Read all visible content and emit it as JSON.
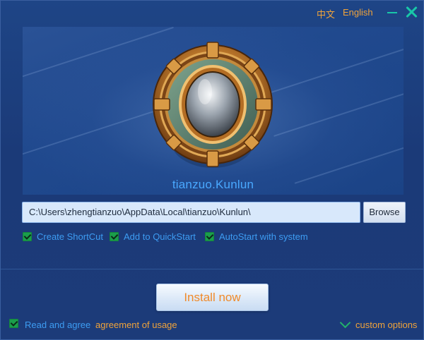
{
  "title_bar": {
    "lang_cn": "中文",
    "lang_en": "English",
    "minimize_icon": "minimize-icon",
    "close_icon": "close-icon"
  },
  "banner": {
    "brand_name": "tianzuo.Kunlun",
    "image": "ornate-golden-mirror-logo"
  },
  "install_path": {
    "value": "C:\\Users\\zhengtianzuo\\AppData\\Local\\tianzuo\\Kunlun\\",
    "browse_label": "Browse"
  },
  "options": [
    {
      "label": "Create ShortCut",
      "checked": true
    },
    {
      "label": "Add to QuickStart",
      "checked": true
    },
    {
      "label": "AutoStart with system",
      "checked": true
    }
  ],
  "install_button": "Install now",
  "footer": {
    "agree_checked": true,
    "agree_label": "Read and agree",
    "agreement_link": "agreement of usage",
    "custom_options_label": "custom options"
  },
  "colors": {
    "background": "#1b3a78",
    "accent_orange": "#f0a33a",
    "link_blue": "#3d9cf2",
    "check_green": "#1b9e4b",
    "window_controls": "#19c7a8"
  }
}
